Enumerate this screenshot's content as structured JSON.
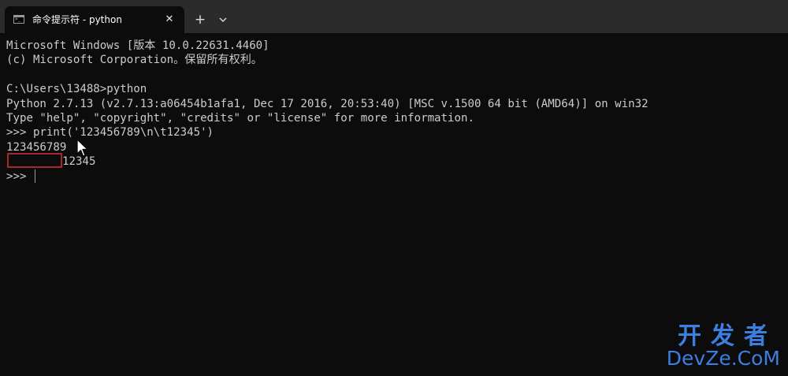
{
  "tab": {
    "title": "命令提示符 - python",
    "close_glyph": "✕",
    "icon": "cmd-prompt-icon",
    "icon_prompt": ">_"
  },
  "toolbar": {
    "new_tab_glyph": "+",
    "dropdown_icon": "chevron-down-icon"
  },
  "console": {
    "lines": [
      "Microsoft Windows [版本 10.0.22631.4460]",
      "(c) Microsoft Corporation。保留所有权利。",
      "",
      "C:\\Users\\13488>python",
      "Python 2.7.13 (v2.7.13:a06454b1afa1, Dec 17 2016, 20:53:40) [MSC v.1500 64 bit (AMD64)] on win32",
      "Type \"help\", \"copyright\", \"credits\" or \"license\" for more information.",
      ">>> print('123456789\\n\\t12345')",
      "123456789"
    ],
    "tab_output_text": "12345",
    "prompt": ">>> "
  },
  "watermark": {
    "cn": "开发者",
    "en": "DevZe.CoM"
  },
  "colors": {
    "background": "#0c0c0c",
    "titlebar": "#2b2b2b",
    "text": "#cccccc",
    "highlight_box": "#a8282c",
    "watermark": "#3d7fe0"
  }
}
